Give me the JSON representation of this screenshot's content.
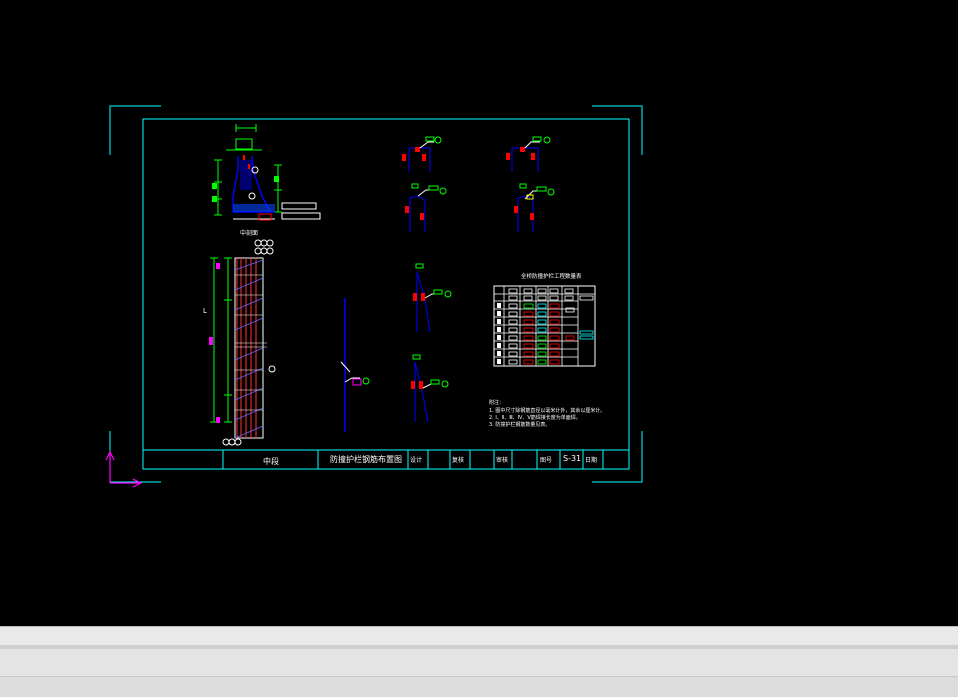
{
  "colors": {
    "background": "#000000",
    "frame": "#00ffff",
    "rebar": "#ff0000",
    "label": "#00ff00",
    "wall": "#0000ff",
    "dimension": "#00ff00",
    "magenta": "#ff00ff",
    "text": "#ffffff",
    "status_bar": "#e6e6e6"
  },
  "title_block": {
    "view_name": "中段",
    "drawing_title": "防撞护栏钢筋布置图",
    "design": "设计",
    "review": "复核",
    "check": "审核",
    "drawing_no_label": "图号",
    "drawing_no": "S-31",
    "date": "日期"
  },
  "drawing": {
    "section_label": "中剖面",
    "elevation_label": "L",
    "table_title": "全桥防撞护栏工程数量表",
    "notes_title": "附注：",
    "notes": [
      "1. 图中尺寸除钢筋直径以毫米计外，其余以厘米计。",
      "2. Ⅰ、Ⅱ、Ⅲ、Ⅳ、Ⅴ筋焊接长度为单面焊。",
      "3. 防撞护栏钢筋数量见表。"
    ]
  },
  "ucs_icon": "ucs-axis-icon"
}
